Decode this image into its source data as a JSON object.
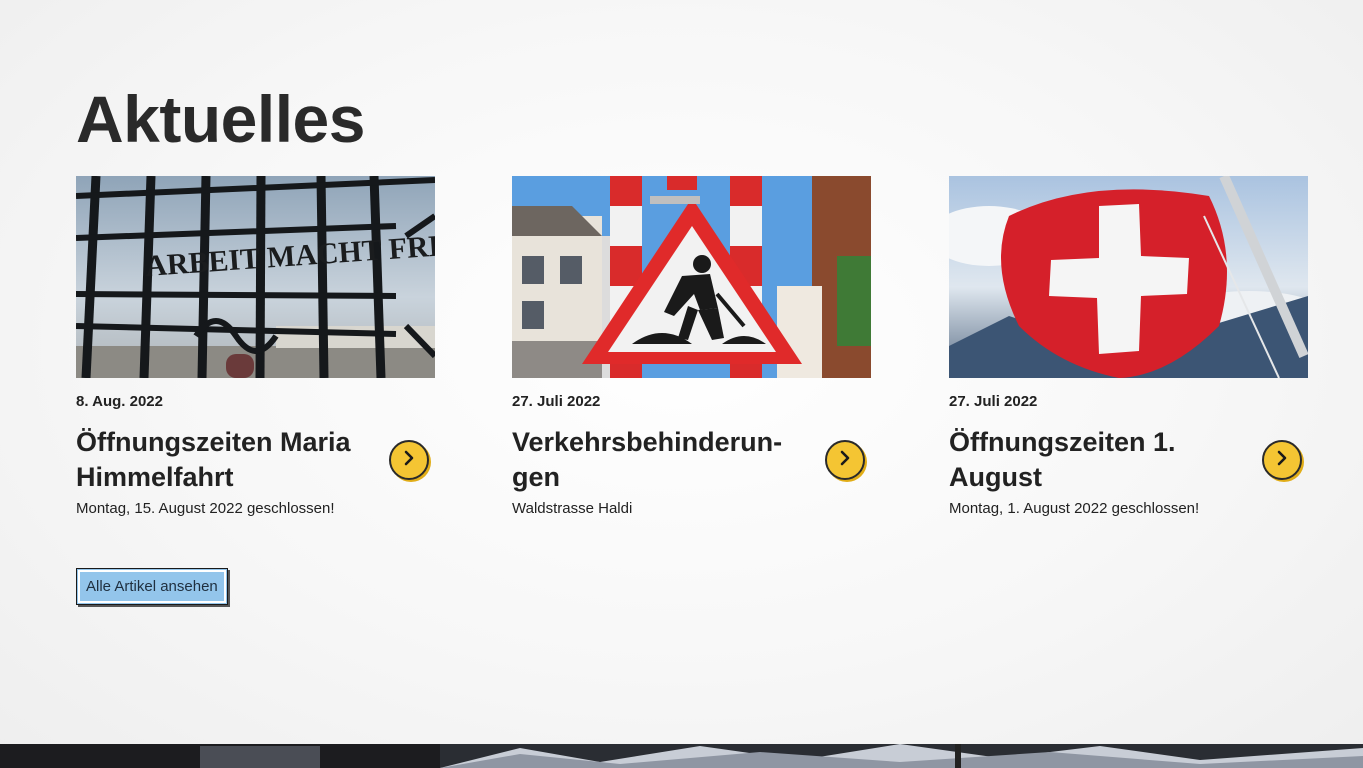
{
  "section": {
    "title": "Aktuelles"
  },
  "articles": [
    {
      "date": "8. Aug. 2022",
      "title": "Öffnungszeiten Maria Himmelfahrt",
      "teaser": "Montag, 15. August 2022 geschlossen!",
      "image": "gate-with-inscription-photo",
      "image_text": "ARBEIT MACHT FREI"
    },
    {
      "date": "27. Juli 2022",
      "title": "Verkehrsbehinderun-gen",
      "teaser": "Waldstrasse Haldi",
      "image": "roadwork-warning-sign-photo"
    },
    {
      "date": "27. Juli 2022",
      "title": "Öffnungszeiten 1. August",
      "teaser": "Montag, 1. August 2022 geschlossen!",
      "image": "swiss-flag-photo"
    }
  ],
  "all_articles_button": "Alle Artikel ansehen",
  "icons": {
    "arrow": "chevron-right-icon"
  },
  "colors": {
    "accent_yellow": "#f4c533",
    "button_blue": "#93c5eb",
    "text": "#222222"
  }
}
